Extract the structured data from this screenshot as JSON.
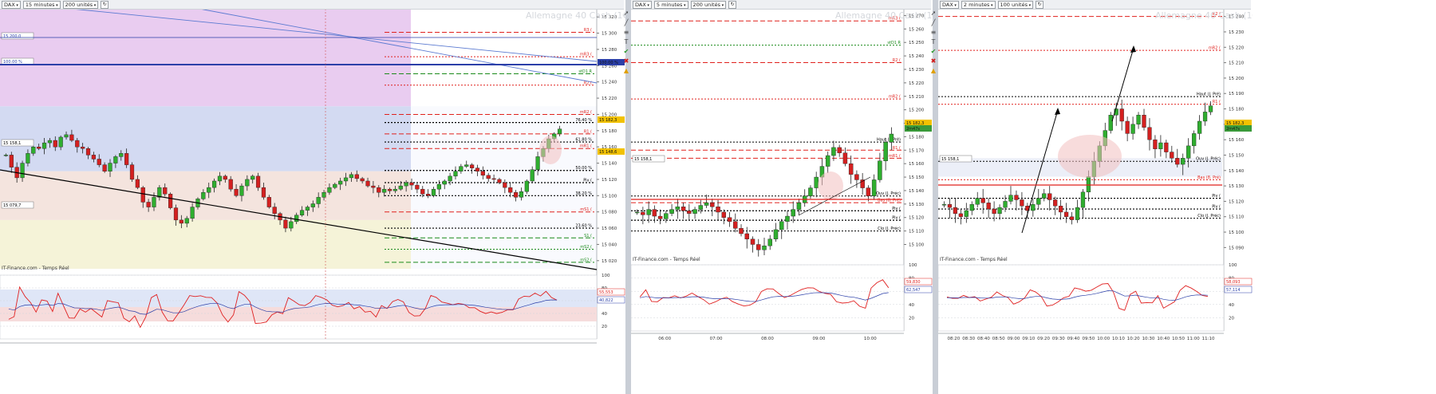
{
  "panels": [
    {
      "instrument": "DAX",
      "timeframe": "15 minutes",
      "units": "200 unités",
      "watermark": "Allemagne 40 Cash (1€)",
      "source": "IT-Finance.com - Temps Réel",
      "price_ticks": [
        "15 320",
        "15 300",
        "15 280",
        "15 260",
        "15 240",
        "15 220",
        "15 200",
        "15 180",
        "15 160",
        "15 140",
        "15 120",
        "15 100",
        "15 080",
        "15 060",
        "15 040",
        "15 020"
      ],
      "osc_ticks": [
        "100",
        "80",
        "60",
        "40",
        "20"
      ],
      "levels": [
        {
          "label": "R3 (",
          "color": "#e0201c"
        },
        {
          "label": "mR3 (",
          "color": "#e0201c"
        },
        {
          "label": "stD1 R",
          "color": "#1a8a1a"
        },
        {
          "label": "R2 (",
          "color": "#e0201c"
        },
        {
          "label": "mR2 (",
          "color": "#e0201c"
        },
        {
          "label": "76.40 %",
          "color": "#000000"
        },
        {
          "label": "R1 (",
          "color": "#e0201c"
        },
        {
          "label": "61.80 %",
          "color": "#000000"
        },
        {
          "label": "mR1 (",
          "color": "#e0201c"
        },
        {
          "label": "50.00 %",
          "color": "#000000"
        },
        {
          "label": "Piv (",
          "color": "#000000"
        },
        {
          "label": "38.20 %",
          "color": "#000000"
        },
        {
          "label": "mS1 (",
          "color": "#e0201c"
        },
        {
          "label": "23.60 %",
          "color": "#000000"
        },
        {
          "label": "S1 (",
          "color": "#1a8a1a"
        },
        {
          "label": "mS2 (",
          "color": "#1a8a1a"
        },
        {
          "label": "mS2 (",
          "color": "#1a8a1a"
        }
      ],
      "flags": [
        {
          "label": "15 200,0",
          "color": "#2b3fa8"
        },
        {
          "label": "100.00 %",
          "color": "#2b3fa8"
        },
        {
          "label": "15 158,1",
          "color": "#000000"
        },
        {
          "label": "15 079,7",
          "color": "#000000"
        }
      ],
      "price_badges": [
        {
          "label": "15 182,3",
          "color": "#f2c200"
        },
        {
          "label": "15 148,6",
          "color": "#f2c200"
        },
        {
          "label": "100.00 %",
          "color": "#2b3fa8"
        }
      ],
      "osc_badges": [
        {
          "label": "55,553",
          "color": "#e0201c"
        },
        {
          "label": "40,822",
          "color": "#2b3fa8"
        }
      ],
      "time_ticks": []
    },
    {
      "instrument": "DAX",
      "timeframe": "5 minutes",
      "units": "200 unités",
      "watermark": "Allemagne 40 Cash (1€)",
      "source": "IT-Finance.com - Temps Réel",
      "price_ticks": [
        "15 270",
        "15 260",
        "15 250",
        "15 240",
        "15 230",
        "15 220",
        "15 210",
        "15 200",
        "15 190",
        "15 180",
        "15 170",
        "15 160",
        "15 150",
        "15 140",
        "15 130",
        "15 120",
        "15 110",
        "15 100"
      ],
      "osc_ticks": [
        "100",
        "80",
        "60",
        "40",
        "20"
      ],
      "levels": [
        {
          "label": "mR3 (",
          "color": "#e0201c"
        },
        {
          "label": "stD1 R",
          "color": "#1a8a1a"
        },
        {
          "label": "R2 (",
          "color": "#e0201c"
        },
        {
          "label": "mR2 (",
          "color": "#e0201c"
        },
        {
          "label": "R1 (",
          "color": "#e0201c"
        },
        {
          "label": "Haut (J. Pré)",
          "color": "#000000"
        },
        {
          "label": "mR1 (",
          "color": "#e0201c"
        },
        {
          "label": "Ouv (J. Préc)",
          "color": "#000000"
        },
        {
          "label": "Bas (8. Pré)",
          "color": "#e0201c"
        },
        {
          "label": "Piv (",
          "color": "#000000"
        },
        {
          "label": "Piv (",
          "color": "#000000"
        },
        {
          "label": "Clo (J. Préc)",
          "color": "#000000"
        }
      ],
      "flags": [
        {
          "label": "15 158,1",
          "color": "#000000"
        }
      ],
      "price_badges": [
        {
          "label": "15 182,3",
          "color": "#f2c200"
        },
        {
          "label": "2m47s",
          "color": "#3a9a3a"
        }
      ],
      "osc_badges": [
        {
          "label": "59,830",
          "color": "#e0201c"
        },
        {
          "label": "62,547",
          "color": "#2b3fa8"
        }
      ],
      "time_ticks": [
        "06:00",
        "07:00",
        "08:00",
        "09:00",
        "10:00"
      ]
    },
    {
      "instrument": "DAX",
      "timeframe": "2 minutes",
      "units": "100 unités",
      "watermark": "Allemagne 40 Cash (1€)",
      "source": "IT-Finance.com - Temps Réel",
      "price_ticks": [
        "15 240",
        "15 230",
        "15 220",
        "15 210",
        "15 200",
        "15 190",
        "15 180",
        "15 170",
        "15 160",
        "15 150",
        "15 140",
        "15 130",
        "15 120",
        "15 110",
        "15 100",
        "15 090"
      ],
      "osc_ticks": [
        "100",
        "80",
        "60",
        "40",
        "20"
      ],
      "levels": [
        {
          "label": "R2 (",
          "color": "#e0201c"
        },
        {
          "label": "mR2 (",
          "color": "#e0201c"
        },
        {
          "label": "Haut (J. Pré)",
          "color": "#000000"
        },
        {
          "label": "R1 (",
          "color": "#e0201c"
        },
        {
          "label": "Ouv (J. Préc)",
          "color": "#000000"
        },
        {
          "label": "Bas (8. Pré)",
          "color": "#e0201c"
        },
        {
          "label": "Piv (",
          "color": "#000000"
        },
        {
          "label": "Piv (",
          "color": "#000000"
        },
        {
          "label": "Clo (J. Préc)",
          "color": "#000000"
        }
      ],
      "flags": [
        {
          "label": "15 158,1",
          "color": "#000000"
        }
      ],
      "price_badges": [
        {
          "label": "15 182,3",
          "color": "#f2c200"
        },
        {
          "label": "2m47s",
          "color": "#3a9a3a"
        }
      ],
      "osc_badges": [
        {
          "label": "58,093",
          "color": "#e0201c"
        },
        {
          "label": "57,114",
          "color": "#2b3fa8"
        }
      ],
      "time_ticks": [
        "08:20",
        "08:30",
        "08:40",
        "08:50",
        "09:00",
        "09:10",
        "09:20",
        "09:30",
        "09:40",
        "09:50",
        "10:00",
        "10:10",
        "10:20",
        "10:30",
        "10:40",
        "10:50",
        "11:00",
        "11:10"
      ]
    }
  ],
  "chart_data": [
    {
      "type": "candlestick",
      "title": "Allemagne 40 Cash (1€)",
      "timeframe": "15 minutes",
      "ylim": [
        15010,
        15330
      ],
      "last_price": 15182.3,
      "close": [
        15150,
        15135,
        15122,
        15140,
        15152,
        15160,
        15158,
        15165,
        15168,
        15160,
        15172,
        15175,
        15168,
        15160,
        15158,
        15150,
        15145,
        15138,
        15130,
        15140,
        15148,
        15152,
        15138,
        15120,
        15110,
        15092,
        15086,
        15098,
        15110,
        15102,
        15085,
        15070,
        15066,
        15072,
        15086,
        15096,
        15104,
        15110,
        15118,
        15124,
        15120,
        15108,
        15100,
        15112,
        15120,
        15124,
        15110,
        15098,
        15086,
        15078,
        15070,
        15060,
        15068,
        15076,
        15082,
        15086,
        15090,
        15098,
        15104,
        15110,
        15114,
        15118,
        15122,
        15126,
        15121,
        15118,
        15112,
        15110,
        15104,
        15108,
        15106,
        15108,
        15112,
        15116,
        15113,
        15108,
        15102,
        15100,
        15108,
        15114,
        15118,
        15124,
        15130,
        15136,
        15138,
        15134,
        15130,
        15125,
        15121,
        15120,
        15116,
        15110,
        15104,
        15098,
        15105,
        15118,
        15132,
        15148,
        15158,
        15170,
        15176,
        15182
      ]
    },
    {
      "type": "candlestick",
      "title": "Allemagne 40 Cash (1€)",
      "timeframe": "5 minutes",
      "ylim": [
        15092,
        15275
      ],
      "last_price": 15182.3,
      "x_ticks": [
        "06:00",
        "07:00",
        "08:00",
        "09:00",
        "10:00"
      ],
      "close": [
        15124,
        15122,
        15126,
        15121,
        15119,
        15123,
        15126,
        15128,
        15125,
        15123,
        15126,
        15129,
        15131,
        15128,
        15124,
        15120,
        15117,
        15112,
        15108,
        15104,
        15100,
        15096,
        15099,
        15104,
        15111,
        15117,
        15121,
        15126,
        15131,
        15136,
        15142,
        15150,
        15158,
        15166,
        15172,
        15168,
        15160,
        15152,
        15148,
        15142,
        15136,
        15148,
        15162,
        15176,
        15182
      ]
    },
    {
      "type": "candlestick",
      "title": "Allemagne 40 Cash (1€)",
      "timeframe": "2 minutes",
      "ylim": [
        15085,
        15245
      ],
      "last_price": 15182.3,
      "x_ticks": [
        "08:20",
        "08:30",
        "08:40",
        "08:50",
        "09:00",
        "09:10",
        "09:20",
        "09:30",
        "09:40",
        "09:50",
        "10:00",
        "10:10",
        "10:20",
        "10:30",
        "10:40",
        "10:50",
        "11:00",
        "11:10"
      ],
      "close": [
        15118,
        15116,
        15112,
        15110,
        15114,
        15118,
        15122,
        15119,
        15115,
        15112,
        15116,
        15120,
        15124,
        15121,
        15117,
        15114,
        15118,
        15122,
        15125,
        15121,
        15117,
        15113,
        15110,
        15108,
        15116,
        15126,
        15136,
        15146,
        15156,
        15166,
        15176,
        15180,
        15172,
        15164,
        15170,
        15176,
        15168,
        15160,
        15154,
        15158,
        15152,
        15148,
        15144,
        15148,
        15156,
        15164,
        15172,
        15178,
        15182
      ]
    }
  ]
}
